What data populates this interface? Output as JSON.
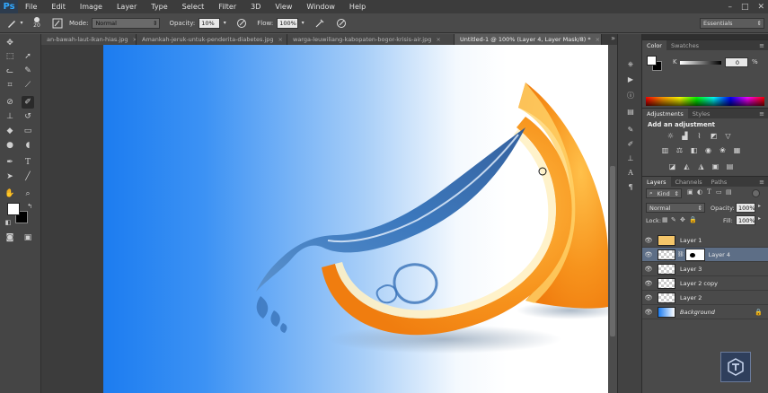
{
  "app": {
    "logo": "Ps"
  },
  "menubar": {
    "items": [
      "File",
      "Edit",
      "Image",
      "Layer",
      "Type",
      "Select",
      "Filter",
      "3D",
      "View",
      "Window",
      "Help"
    ],
    "window_controls": [
      "–",
      "□",
      "✕"
    ]
  },
  "options": {
    "brush_size": "20",
    "mode_label": "Mode:",
    "mode_value": "Normal",
    "opacity_label": "Opacity:",
    "opacity_value": "10%",
    "flow_label": "Flow:",
    "flow_value": "100%",
    "workspace": "Essentials"
  },
  "doc_tabs": [
    {
      "label": "an-bawah-laut-ikan-hias.jpg",
      "active": false
    },
    {
      "label": "Amankah-jeruk-untuk-penderita-diabetes.jpg",
      "active": false
    },
    {
      "label": "warga-leuwiliang-kabopaten-bogor-krisis-air.jpg",
      "active": false
    },
    {
      "label": "Untitled-1 @ 100% (Layer 4, Layer Mask/8) *",
      "active": true
    }
  ],
  "color_panel": {
    "tabs": [
      "Color",
      "Swatches"
    ],
    "channel_label": "K",
    "channel_value": "0",
    "percent": "%"
  },
  "adjustments_panel": {
    "tabs": [
      "Adjustments",
      "Styles"
    ],
    "heading": "Add an adjustment"
  },
  "layers_panel": {
    "tabs": [
      "Layers",
      "Channels",
      "Paths"
    ],
    "kind_label": "Kind",
    "blend_mode": "Normal",
    "opacity_label": "Opacity:",
    "opacity_value": "100%",
    "lock_label": "Lock:",
    "fill_label": "Fill:",
    "fill_value": "100%",
    "layers": [
      {
        "name": "Layer 1",
        "selected": false
      },
      {
        "name": "Layer 4",
        "selected": true
      },
      {
        "name": "Layer 3",
        "selected": false
      },
      {
        "name": "Layer 2 copy",
        "selected": false
      },
      {
        "name": "Layer 2",
        "selected": false
      },
      {
        "name": "Background",
        "selected": false
      }
    ]
  },
  "colors": {
    "accent": "#31a8ff",
    "selected_layer": "#5d6e86",
    "canvas_blue": "#1c7cf0",
    "orange": "#f7941d"
  }
}
